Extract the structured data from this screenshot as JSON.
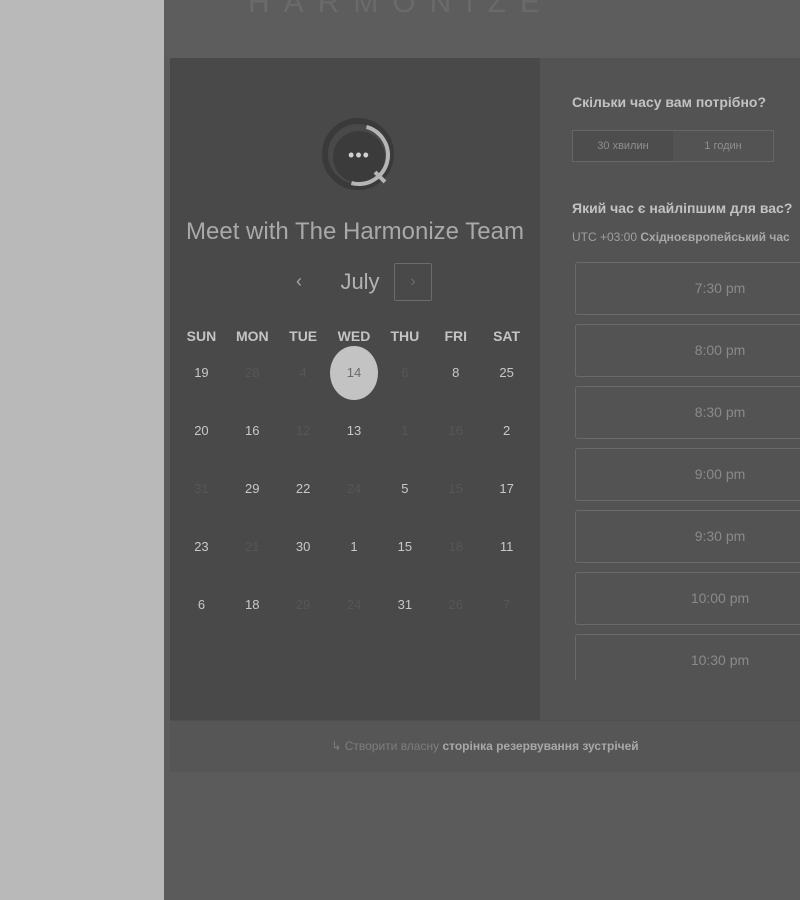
{
  "brand": {
    "logo_text": "HARMONIZE"
  },
  "calendar": {
    "title": "Meet with The Harmonize Team",
    "month": "July",
    "prev_icon": "‹",
    "next_icon": "›",
    "weekdays": [
      "SUN",
      "MON",
      "TUE",
      "WED",
      "THU",
      "FRI",
      "SAT"
    ],
    "weeks": [
      [
        {
          "d": "19",
          "s": "on"
        },
        {
          "d": "28",
          "s": "off"
        },
        {
          "d": "4",
          "s": "off"
        },
        {
          "d": "14",
          "s": "sel"
        },
        {
          "d": "6",
          "s": "off"
        },
        {
          "d": "8",
          "s": "on"
        },
        {
          "d": "25",
          "s": "on"
        }
      ],
      [
        {
          "d": "20",
          "s": "on"
        },
        {
          "d": "16",
          "s": "on"
        },
        {
          "d": "12",
          "s": "off"
        },
        {
          "d": "13",
          "s": "on"
        },
        {
          "d": "1",
          "s": "off"
        },
        {
          "d": "16",
          "s": "off"
        },
        {
          "d": "2",
          "s": "on"
        }
      ],
      [
        {
          "d": "31",
          "s": "off"
        },
        {
          "d": "29",
          "s": "on"
        },
        {
          "d": "22",
          "s": "on"
        },
        {
          "d": "24",
          "s": "off"
        },
        {
          "d": "5",
          "s": "on"
        },
        {
          "d": "15",
          "s": "off"
        },
        {
          "d": "17",
          "s": "on"
        }
      ],
      [
        {
          "d": "23",
          "s": "on"
        },
        {
          "d": "21",
          "s": "off"
        },
        {
          "d": "30",
          "s": "on"
        },
        {
          "d": "1",
          "s": "on"
        },
        {
          "d": "15",
          "s": "on"
        },
        {
          "d": "18",
          "s": "off"
        },
        {
          "d": "11",
          "s": "on"
        }
      ],
      [
        {
          "d": "6",
          "s": "on"
        },
        {
          "d": "18",
          "s": "on"
        },
        {
          "d": "29",
          "s": "off"
        },
        {
          "d": "24",
          "s": "off"
        },
        {
          "d": "31",
          "s": "on"
        },
        {
          "d": "26",
          "s": "off"
        },
        {
          "d": "7",
          "s": "off"
        }
      ]
    ]
  },
  "booking": {
    "duration_question": "Скільки часу вам потрібно?",
    "durations": [
      "30 хвилин",
      "1 годин"
    ],
    "time_question": "Який час є найліпшим для вас?",
    "timezone_prefix": "UTC +03:00",
    "timezone_name": "Східноєвропейський час",
    "slots": [
      "7:30 pm",
      "8:00 pm",
      "8:30 pm",
      "9:00 pm",
      "9:30 pm",
      "10:00 pm",
      "10:30 pm"
    ]
  },
  "footer": {
    "icon": "↳",
    "prefix": "Створити власну",
    "link": "сторінка резервування зустрічей"
  }
}
